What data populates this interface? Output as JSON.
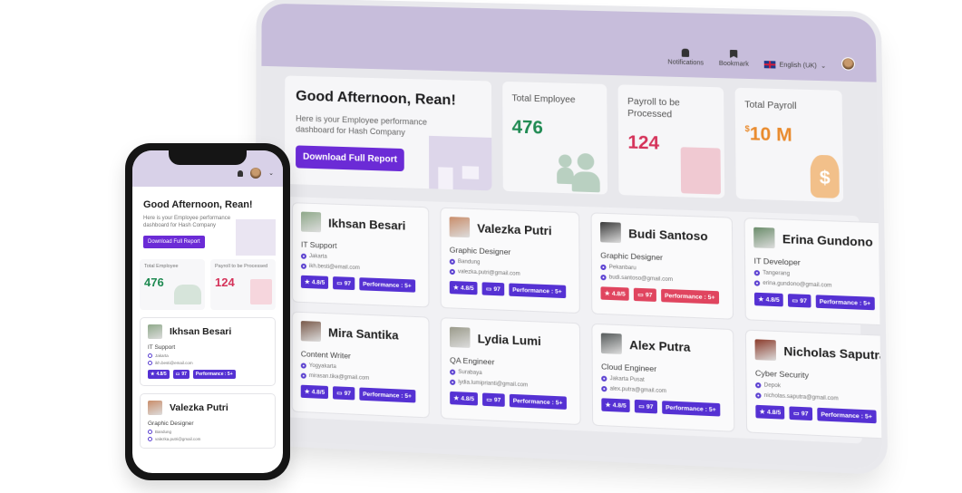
{
  "colors": {
    "header": "#c7bddb",
    "accent": "#6b2bd6",
    "badge": "#5531d3",
    "badge_alert": "#e0455f",
    "employee_green": "#1f8a52",
    "payroll_pink": "#d5335a",
    "total_orange": "#e98b2e"
  },
  "tablet": {
    "topbar": {
      "notifications_label": "Notifications",
      "bookmark_label": "Bookmark",
      "language_label": "English (UK)"
    },
    "welcome": {
      "title": "Good Afternoon, Rean!",
      "subtitle": "Here is your Employee performance dashboard for Hash Company",
      "button_label": "Download Full Report"
    },
    "stats": [
      {
        "label": "Total Employee",
        "value": "476"
      },
      {
        "label": "Payroll to be Processed",
        "value": "124"
      },
      {
        "label": "Total Payroll",
        "currency": "$",
        "value": "10 M"
      }
    ],
    "employees": [
      {
        "name": "Ikhsan Besari",
        "role": "IT Support",
        "location": "Jakarta",
        "email": "ikh.besti@email.com",
        "rating": "4.8/5",
        "comments": "97",
        "performance": "Performance : 5+",
        "alert": false
      },
      {
        "name": "Valezka Putri",
        "role": "Graphic Designer",
        "location": "Bandung",
        "email": "valezka.putri@gmail.com",
        "rating": "4.8/5",
        "comments": "97",
        "performance": "Performance : 5+",
        "alert": false
      },
      {
        "name": "Budi Santoso",
        "role": "Graphic Designer",
        "location": "Pekanbaru",
        "email": "budi.santoso@gmail.com",
        "rating": "4.8/5",
        "comments": "97",
        "performance": "Performance : 5+",
        "alert": true
      },
      {
        "name": "Erina Gundono",
        "role": "IT Developer",
        "location": "Tangerang",
        "email": "erina.gundono@gmail.com",
        "rating": "4.8/5",
        "comments": "97",
        "performance": "Performance : 5+",
        "alert": false
      },
      {
        "name": "Mira Santika",
        "role": "Content Writer",
        "location": "Yogyakarta",
        "email": "mirasan.tika@gmail.com",
        "rating": "4.8/5",
        "comments": "97",
        "performance": "Performance : 5+",
        "alert": false
      },
      {
        "name": "Lydia Lumi",
        "role": "QA Engineer",
        "location": "Surabaya",
        "email": "lydia.lumiprianti@gmail.com",
        "rating": "4.8/5",
        "comments": "97",
        "performance": "Performance : 5+",
        "alert": false
      },
      {
        "name": "Alex Putra",
        "role": "Cloud Engineer",
        "location": "Jakarta Pusat",
        "email": "alex.putra@gmail.com",
        "rating": "4.8/5",
        "comments": "97",
        "performance": "Performance : 5+",
        "alert": false
      },
      {
        "name": "Nicholas Saputra",
        "role": "Cyber Security",
        "location": "Depok",
        "email": "nicholas.saputra@gmail.com",
        "rating": "4.8/5",
        "comments": "97",
        "performance": "Performance : 5+",
        "alert": false
      }
    ]
  },
  "phone": {
    "welcome": {
      "title": "Good Afternoon, Rean!",
      "subtitle": "Here is your Employee performance dashboard for Hash Company",
      "button_label": "Download Full Report"
    },
    "stats": [
      {
        "label": "Total Employee",
        "value": "476"
      },
      {
        "label": "Payroll to be Processed",
        "value": "124"
      }
    ],
    "employees": [
      {
        "name": "Ikhsan Besari",
        "role": "IT Support",
        "location": "Jakarta",
        "email": "ikh.besti@email.com",
        "rating": "4.8/5",
        "comments": "97",
        "performance": "Performance : 5+"
      },
      {
        "name": "Valezka Putri",
        "role": "Graphic Designer",
        "location": "Bandung",
        "email": "valezka.putri@gmail.com"
      }
    ]
  }
}
